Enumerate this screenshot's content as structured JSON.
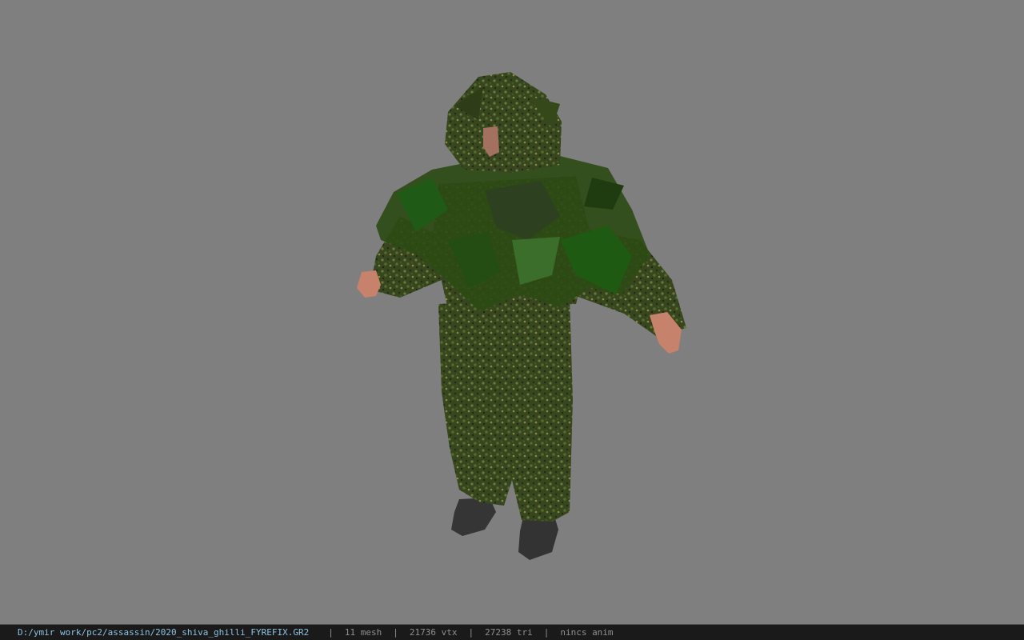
{
  "viewer": {
    "background_color": "#7f7f7f",
    "model_name": "ghillie-suit-character"
  },
  "status_bar": {
    "file_path": "D:/ymir work/pc2/assassin/2020_shiva_ghilli_FYREFIX.GR2",
    "separator": "|",
    "mesh_count": "11 mesh",
    "vertex_count": "21736 vtx",
    "triangle_count": "27238 tri",
    "animation": "nincs anim",
    "path_color": "#8ec1e0",
    "text_color": "#8f8f8f"
  }
}
